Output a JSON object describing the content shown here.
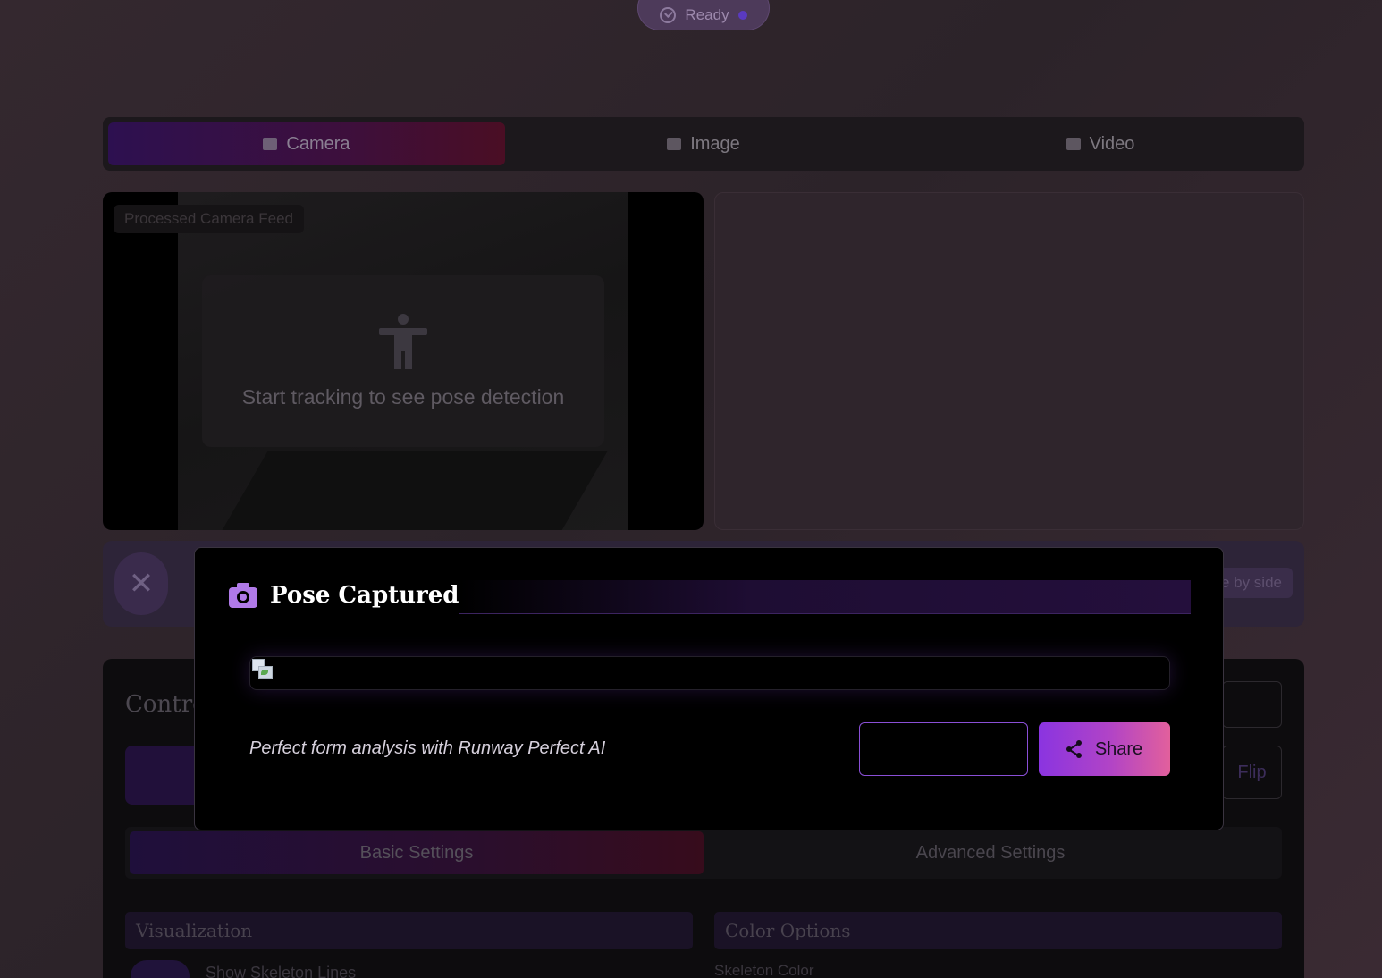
{
  "status": {
    "label": "Ready"
  },
  "mode_tabs": [
    {
      "label": "Camera",
      "icon": "video-camera-icon",
      "active": true
    },
    {
      "label": "Image",
      "icon": "image-icon",
      "active": false
    },
    {
      "label": "Video",
      "icon": "film-icon",
      "active": false
    }
  ],
  "camera": {
    "feed_label": "Processed Camera Feed",
    "placeholder_text": "Start tracking to see pose detection"
  },
  "toolbar": {
    "side_by_side_label": "e by side"
  },
  "controls": {
    "title": "Contro",
    "flip_label": "Flip",
    "settings_tabs": [
      {
        "label": "Basic Settings",
        "active": true
      },
      {
        "label": "Advanced Settings",
        "active": false
      }
    ],
    "visualization_heading": "Visualization",
    "color_heading": "Color Options",
    "visualization_item": "Show Skeleton Lines",
    "color_item": "Skeleton Color"
  },
  "modal": {
    "title": "Pose Captured",
    "caption": "Perfect form analysis with Runway Perfect AI",
    "share_label": "Share"
  },
  "colors": {
    "accent_purple": "#8a34e0",
    "accent_pink": "#e2609c",
    "camera_icon": "#b07ae8"
  }
}
